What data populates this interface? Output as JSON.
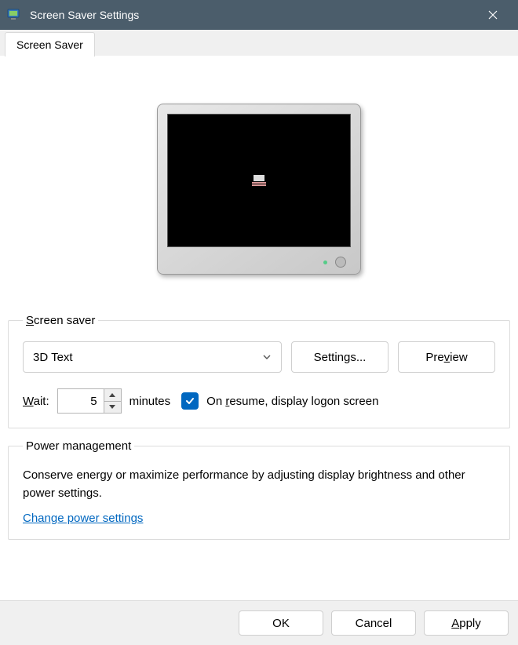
{
  "title": "Screen Saver Settings",
  "tab": "Screen Saver",
  "screensaver": {
    "legend": "Screen saver",
    "selected": "3D Text",
    "settings_btn": "Settings...",
    "preview_btn": "Preview",
    "wait_label": "Wait:",
    "wait_value": "5",
    "minutes_label": "minutes",
    "resume_label_pre": "On ",
    "resume_label_u": "r",
    "resume_label_post": "esume, display logon screen",
    "resume_checked": true
  },
  "power": {
    "legend": "Power management",
    "desc": "Conserve energy or maximize performance by adjusting display brightness and other power settings.",
    "link": "Change power settings"
  },
  "footer": {
    "ok": "OK",
    "cancel": "Cancel",
    "apply": "Apply"
  }
}
